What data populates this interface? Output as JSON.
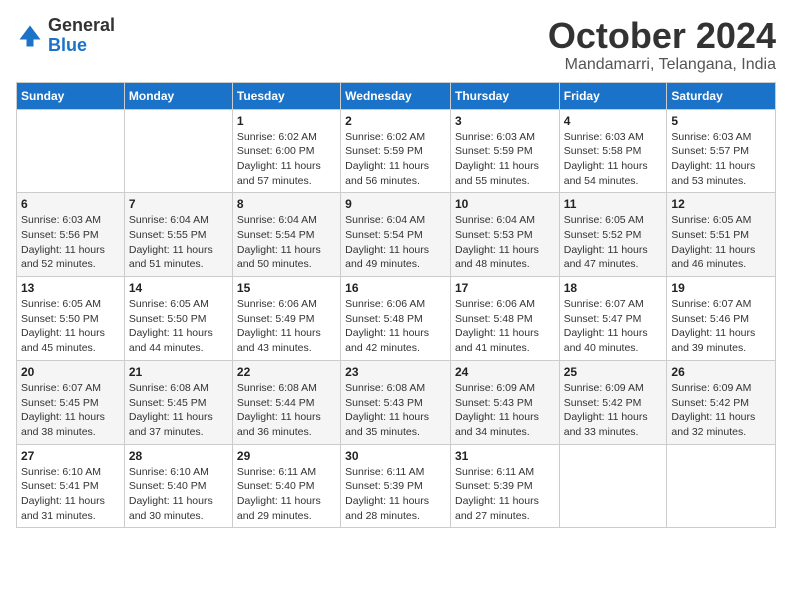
{
  "logo": {
    "general": "General",
    "blue": "Blue"
  },
  "header": {
    "month": "October 2024",
    "location": "Mandamarri, Telangana, India"
  },
  "days_of_week": [
    "Sunday",
    "Monday",
    "Tuesday",
    "Wednesday",
    "Thursday",
    "Friday",
    "Saturday"
  ],
  "weeks": [
    [
      {
        "day": "",
        "sunrise": "",
        "sunset": "",
        "daylight": ""
      },
      {
        "day": "",
        "sunrise": "",
        "sunset": "",
        "daylight": ""
      },
      {
        "day": "1",
        "sunrise": "Sunrise: 6:02 AM",
        "sunset": "Sunset: 6:00 PM",
        "daylight": "Daylight: 11 hours and 57 minutes."
      },
      {
        "day": "2",
        "sunrise": "Sunrise: 6:02 AM",
        "sunset": "Sunset: 5:59 PM",
        "daylight": "Daylight: 11 hours and 56 minutes."
      },
      {
        "day": "3",
        "sunrise": "Sunrise: 6:03 AM",
        "sunset": "Sunset: 5:59 PM",
        "daylight": "Daylight: 11 hours and 55 minutes."
      },
      {
        "day": "4",
        "sunrise": "Sunrise: 6:03 AM",
        "sunset": "Sunset: 5:58 PM",
        "daylight": "Daylight: 11 hours and 54 minutes."
      },
      {
        "day": "5",
        "sunrise": "Sunrise: 6:03 AM",
        "sunset": "Sunset: 5:57 PM",
        "daylight": "Daylight: 11 hours and 53 minutes."
      }
    ],
    [
      {
        "day": "6",
        "sunrise": "Sunrise: 6:03 AM",
        "sunset": "Sunset: 5:56 PM",
        "daylight": "Daylight: 11 hours and 52 minutes."
      },
      {
        "day": "7",
        "sunrise": "Sunrise: 6:04 AM",
        "sunset": "Sunset: 5:55 PM",
        "daylight": "Daylight: 11 hours and 51 minutes."
      },
      {
        "day": "8",
        "sunrise": "Sunrise: 6:04 AM",
        "sunset": "Sunset: 5:54 PM",
        "daylight": "Daylight: 11 hours and 50 minutes."
      },
      {
        "day": "9",
        "sunrise": "Sunrise: 6:04 AM",
        "sunset": "Sunset: 5:54 PM",
        "daylight": "Daylight: 11 hours and 49 minutes."
      },
      {
        "day": "10",
        "sunrise": "Sunrise: 6:04 AM",
        "sunset": "Sunset: 5:53 PM",
        "daylight": "Daylight: 11 hours and 48 minutes."
      },
      {
        "day": "11",
        "sunrise": "Sunrise: 6:05 AM",
        "sunset": "Sunset: 5:52 PM",
        "daylight": "Daylight: 11 hours and 47 minutes."
      },
      {
        "day": "12",
        "sunrise": "Sunrise: 6:05 AM",
        "sunset": "Sunset: 5:51 PM",
        "daylight": "Daylight: 11 hours and 46 minutes."
      }
    ],
    [
      {
        "day": "13",
        "sunrise": "Sunrise: 6:05 AM",
        "sunset": "Sunset: 5:50 PM",
        "daylight": "Daylight: 11 hours and 45 minutes."
      },
      {
        "day": "14",
        "sunrise": "Sunrise: 6:05 AM",
        "sunset": "Sunset: 5:50 PM",
        "daylight": "Daylight: 11 hours and 44 minutes."
      },
      {
        "day": "15",
        "sunrise": "Sunrise: 6:06 AM",
        "sunset": "Sunset: 5:49 PM",
        "daylight": "Daylight: 11 hours and 43 minutes."
      },
      {
        "day": "16",
        "sunrise": "Sunrise: 6:06 AM",
        "sunset": "Sunset: 5:48 PM",
        "daylight": "Daylight: 11 hours and 42 minutes."
      },
      {
        "day": "17",
        "sunrise": "Sunrise: 6:06 AM",
        "sunset": "Sunset: 5:48 PM",
        "daylight": "Daylight: 11 hours and 41 minutes."
      },
      {
        "day": "18",
        "sunrise": "Sunrise: 6:07 AM",
        "sunset": "Sunset: 5:47 PM",
        "daylight": "Daylight: 11 hours and 40 minutes."
      },
      {
        "day": "19",
        "sunrise": "Sunrise: 6:07 AM",
        "sunset": "Sunset: 5:46 PM",
        "daylight": "Daylight: 11 hours and 39 minutes."
      }
    ],
    [
      {
        "day": "20",
        "sunrise": "Sunrise: 6:07 AM",
        "sunset": "Sunset: 5:45 PM",
        "daylight": "Daylight: 11 hours and 38 minutes."
      },
      {
        "day": "21",
        "sunrise": "Sunrise: 6:08 AM",
        "sunset": "Sunset: 5:45 PM",
        "daylight": "Daylight: 11 hours and 37 minutes."
      },
      {
        "day": "22",
        "sunrise": "Sunrise: 6:08 AM",
        "sunset": "Sunset: 5:44 PM",
        "daylight": "Daylight: 11 hours and 36 minutes."
      },
      {
        "day": "23",
        "sunrise": "Sunrise: 6:08 AM",
        "sunset": "Sunset: 5:43 PM",
        "daylight": "Daylight: 11 hours and 35 minutes."
      },
      {
        "day": "24",
        "sunrise": "Sunrise: 6:09 AM",
        "sunset": "Sunset: 5:43 PM",
        "daylight": "Daylight: 11 hours and 34 minutes."
      },
      {
        "day": "25",
        "sunrise": "Sunrise: 6:09 AM",
        "sunset": "Sunset: 5:42 PM",
        "daylight": "Daylight: 11 hours and 33 minutes."
      },
      {
        "day": "26",
        "sunrise": "Sunrise: 6:09 AM",
        "sunset": "Sunset: 5:42 PM",
        "daylight": "Daylight: 11 hours and 32 minutes."
      }
    ],
    [
      {
        "day": "27",
        "sunrise": "Sunrise: 6:10 AM",
        "sunset": "Sunset: 5:41 PM",
        "daylight": "Daylight: 11 hours and 31 minutes."
      },
      {
        "day": "28",
        "sunrise": "Sunrise: 6:10 AM",
        "sunset": "Sunset: 5:40 PM",
        "daylight": "Daylight: 11 hours and 30 minutes."
      },
      {
        "day": "29",
        "sunrise": "Sunrise: 6:11 AM",
        "sunset": "Sunset: 5:40 PM",
        "daylight": "Daylight: 11 hours and 29 minutes."
      },
      {
        "day": "30",
        "sunrise": "Sunrise: 6:11 AM",
        "sunset": "Sunset: 5:39 PM",
        "daylight": "Daylight: 11 hours and 28 minutes."
      },
      {
        "day": "31",
        "sunrise": "Sunrise: 6:11 AM",
        "sunset": "Sunset: 5:39 PM",
        "daylight": "Daylight: 11 hours and 27 minutes."
      },
      {
        "day": "",
        "sunrise": "",
        "sunset": "",
        "daylight": ""
      },
      {
        "day": "",
        "sunrise": "",
        "sunset": "",
        "daylight": ""
      }
    ]
  ]
}
